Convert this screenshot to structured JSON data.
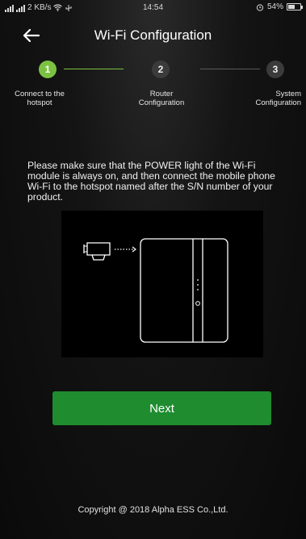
{
  "status_bar": {
    "network_icon": "signal-bars-icon",
    "speed": "2 KB/s",
    "wifi_icon": "wifi-icon",
    "usb_icon": "usb-icon",
    "time": "14:54",
    "alarm_icon": "alarm-icon",
    "battery": "54%",
    "battery_level": 0.54
  },
  "header": {
    "back_icon": "arrow-left-icon",
    "title": "Wi-Fi Configuration"
  },
  "stepper": {
    "steps": [
      {
        "number": "1",
        "label": "Connect to the hotspot",
        "active": true
      },
      {
        "number": "2",
        "label": "Router Configuration",
        "active": false
      },
      {
        "number": "3",
        "label": "System Configuration",
        "active": false
      }
    ]
  },
  "instructions": {
    "text": "Please make sure that the POWER light of the Wi-Fi module is always on, and then connect the mobile phone Wi-Fi to the hotspot named after the S/N number of your product."
  },
  "illustration": {
    "dongle_icon": "wifi-dongle-icon",
    "device_icon": "inverter-device-icon"
  },
  "actions": {
    "next_label": "Next"
  },
  "footer": {
    "copyright": "Copyright @ 2018 Alpha ESS Co.,Ltd."
  },
  "colors": {
    "accent": "#7cc242",
    "button": "#1e8c2f",
    "background": "#0b0b0b"
  }
}
